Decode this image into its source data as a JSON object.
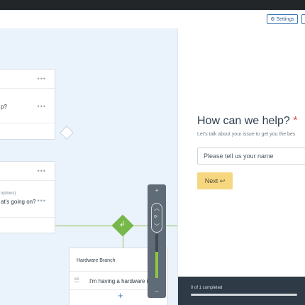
{
  "toolbar": {
    "settings_label": "Settings",
    "settings_icon": "gear-icon"
  },
  "canvas": {
    "card1": {
      "text": "p?",
      "menu": "•••"
    },
    "card2": {
      "sub": "options)",
      "text": "at's going on?",
      "menu": "•••"
    },
    "card3": {
      "title": "Hardware Branch",
      "text": "I'm having a hardware is",
      "add": "+"
    },
    "merge_icon": "return-arrow-icon",
    "zoom": {
      "plus": "+",
      "minus": "−",
      "level": 0.6
    }
  },
  "preview": {
    "question": "How can we help?",
    "required_mark": "*",
    "subtitle": "Let's talk about your issue to get you the bes",
    "input_placeholder": "Please tell us your name",
    "next_label": "Next",
    "next_icon": "↩",
    "progress_text": "0 of 1 completed",
    "progress": 0
  }
}
